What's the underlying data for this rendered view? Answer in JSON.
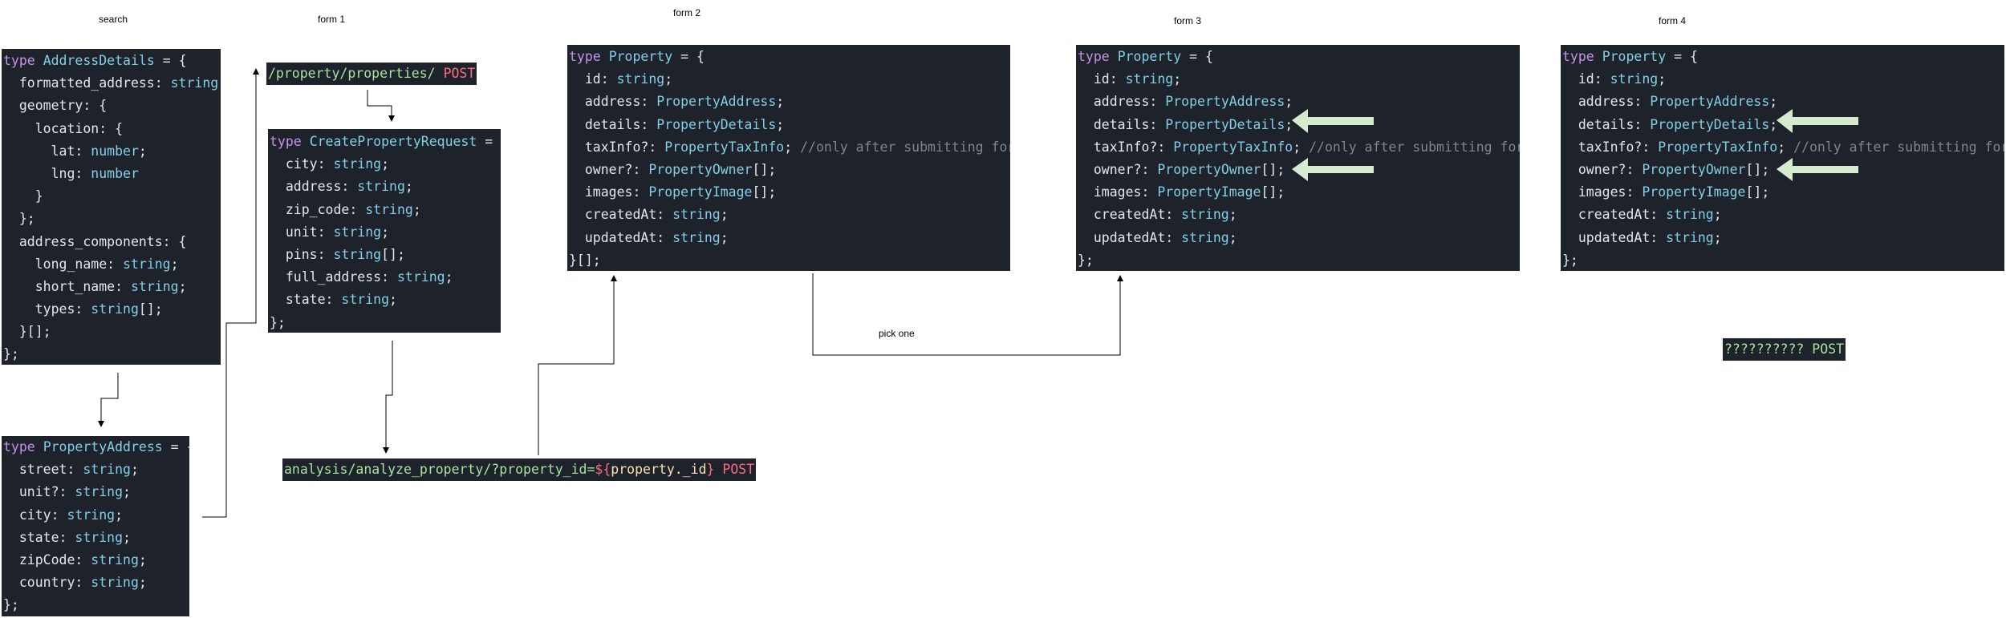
{
  "labels": {
    "search": "search",
    "form1": "form 1",
    "form2": "form 2",
    "form3": "form 3",
    "form4": "form 4",
    "pick_one": "pick one"
  },
  "endpoints": {
    "create_path": "/property/properties/",
    "create_method": "POST",
    "analyze_path": "analysis/analyze_property/?property_id=",
    "analyze_expr_open": "${",
    "analyze_expr_var": "property._id",
    "analyze_expr_close": "}",
    "analyze_method": "POST",
    "unknown_path": "??????????",
    "unknown_method": "POST"
  },
  "code_blocks": {
    "address_details": [
      [
        [
          "kw",
          "type"
        ],
        [
          "pl",
          " "
        ],
        [
          "ty",
          "AddressDetails"
        ],
        [
          "pl",
          " = {"
        ]
      ],
      [
        [
          "pl",
          "  formatted_address: "
        ],
        [
          "ty",
          "string"
        ],
        [
          "pl",
          ";"
        ]
      ],
      [
        [
          "pl",
          "  geometry: {"
        ]
      ],
      [
        [
          "pl",
          "    location: {"
        ]
      ],
      [
        [
          "pl",
          "      lat: "
        ],
        [
          "ty",
          "number"
        ],
        [
          "pl",
          ";"
        ]
      ],
      [
        [
          "pl",
          "      lng: "
        ],
        [
          "ty",
          "number"
        ]
      ],
      [
        [
          "pl",
          "    }"
        ]
      ],
      [
        [
          "pl",
          "  };"
        ]
      ],
      [
        [
          "pl",
          "  address_components: {"
        ]
      ],
      [
        [
          "pl",
          "    long_name: "
        ],
        [
          "ty",
          "string"
        ],
        [
          "pl",
          ";"
        ]
      ],
      [
        [
          "pl",
          "    short_name: "
        ],
        [
          "ty",
          "string"
        ],
        [
          "pl",
          ";"
        ]
      ],
      [
        [
          "pl",
          "    types: "
        ],
        [
          "ty",
          "string"
        ],
        [
          "pl",
          "[];"
        ]
      ],
      [
        [
          "pl",
          "  }[];"
        ]
      ],
      [
        [
          "pl",
          "};"
        ]
      ]
    ],
    "property_address": [
      [
        [
          "kw",
          "type"
        ],
        [
          "pl",
          " "
        ],
        [
          "ty",
          "PropertyAddress"
        ],
        [
          "pl",
          " = {"
        ]
      ],
      [
        [
          "pl",
          "  street: "
        ],
        [
          "ty",
          "string"
        ],
        [
          "pl",
          ";"
        ]
      ],
      [
        [
          "pl",
          "  unit?: "
        ],
        [
          "ty",
          "string"
        ],
        [
          "pl",
          ";"
        ]
      ],
      [
        [
          "pl",
          "  city: "
        ],
        [
          "ty",
          "string"
        ],
        [
          "pl",
          ";"
        ]
      ],
      [
        [
          "pl",
          "  state: "
        ],
        [
          "ty",
          "string"
        ],
        [
          "pl",
          ";"
        ]
      ],
      [
        [
          "pl",
          "  zipCode: "
        ],
        [
          "ty",
          "string"
        ],
        [
          "pl",
          ";"
        ]
      ],
      [
        [
          "pl",
          "  country: "
        ],
        [
          "ty",
          "string"
        ],
        [
          "pl",
          ";"
        ]
      ],
      [
        [
          "pl",
          "};"
        ]
      ]
    ],
    "create_property_request": [
      [
        [
          "kw",
          "type"
        ],
        [
          "pl",
          " "
        ],
        [
          "ty",
          "CreatePropertyRequest"
        ],
        [
          "pl",
          " = {"
        ]
      ],
      [
        [
          "pl",
          "  city: "
        ],
        [
          "ty",
          "string"
        ],
        [
          "pl",
          ";"
        ]
      ],
      [
        [
          "pl",
          "  address: "
        ],
        [
          "ty",
          "string"
        ],
        [
          "pl",
          ";"
        ]
      ],
      [
        [
          "pl",
          "  zip_code: "
        ],
        [
          "ty",
          "string"
        ],
        [
          "pl",
          ";"
        ]
      ],
      [
        [
          "pl",
          "  unit: "
        ],
        [
          "ty",
          "string"
        ],
        [
          "pl",
          ";"
        ]
      ],
      [
        [
          "pl",
          "  pins: "
        ],
        [
          "ty",
          "string"
        ],
        [
          "pl",
          "[];"
        ]
      ],
      [
        [
          "pl",
          "  full_address: "
        ],
        [
          "ty",
          "string"
        ],
        [
          "pl",
          ";"
        ]
      ],
      [
        [
          "pl",
          "  state: "
        ],
        [
          "ty",
          "string"
        ],
        [
          "pl",
          ";"
        ]
      ],
      [
        [
          "pl",
          "};"
        ]
      ]
    ],
    "property_form2": [
      [
        [
          "kw",
          "type"
        ],
        [
          "pl",
          " "
        ],
        [
          "ty",
          "Property"
        ],
        [
          "pl",
          " = {"
        ]
      ],
      [
        [
          "pl",
          "  id: "
        ],
        [
          "ty",
          "string"
        ],
        [
          "pl",
          ";"
        ]
      ],
      [
        [
          "pl",
          "  address: "
        ],
        [
          "ty",
          "PropertyAddress"
        ],
        [
          "pl",
          ";"
        ]
      ],
      [
        [
          "pl",
          "  details: "
        ],
        [
          "ty",
          "PropertyDetails"
        ],
        [
          "pl",
          ";"
        ]
      ],
      [
        [
          "pl",
          "  taxInfo?: "
        ],
        [
          "ty",
          "PropertyTaxInfo"
        ],
        [
          "pl",
          "; "
        ],
        [
          "cm",
          "//only after submitting form"
        ]
      ],
      [
        [
          "pl",
          "  owner?: "
        ],
        [
          "ty",
          "PropertyOwner"
        ],
        [
          "pl",
          "[];"
        ]
      ],
      [
        [
          "pl",
          "  images: "
        ],
        [
          "ty",
          "PropertyImage"
        ],
        [
          "pl",
          "[];"
        ]
      ],
      [
        [
          "pl",
          "  createdAt: "
        ],
        [
          "ty",
          "string"
        ],
        [
          "pl",
          ";"
        ]
      ],
      [
        [
          "pl",
          "  updatedAt: "
        ],
        [
          "ty",
          "string"
        ],
        [
          "pl",
          ";"
        ]
      ],
      [
        [
          "pl",
          "}[];"
        ]
      ]
    ],
    "property_form3": [
      [
        [
          "kw",
          "type"
        ],
        [
          "pl",
          " "
        ],
        [
          "ty",
          "Property"
        ],
        [
          "pl",
          " = {"
        ]
      ],
      [
        [
          "pl",
          "  id: "
        ],
        [
          "ty",
          "string"
        ],
        [
          "pl",
          ";"
        ]
      ],
      [
        [
          "pl",
          "  address: "
        ],
        [
          "ty",
          "PropertyAddress"
        ],
        [
          "pl",
          ";"
        ]
      ],
      [
        [
          "pl",
          "  details: "
        ],
        [
          "ty",
          "PropertyDetails"
        ],
        [
          "pl",
          ";"
        ]
      ],
      [
        [
          "pl",
          "  taxInfo?: "
        ],
        [
          "ty",
          "PropertyTaxInfo"
        ],
        [
          "pl",
          "; "
        ],
        [
          "cm",
          "//only after submitting form"
        ]
      ],
      [
        [
          "pl",
          "  owner?: "
        ],
        [
          "ty",
          "PropertyOwner"
        ],
        [
          "pl",
          "[];"
        ]
      ],
      [
        [
          "pl",
          "  images: "
        ],
        [
          "ty",
          "PropertyImage"
        ],
        [
          "pl",
          "[];"
        ]
      ],
      [
        [
          "pl",
          "  createdAt: "
        ],
        [
          "ty",
          "string"
        ],
        [
          "pl",
          ";"
        ]
      ],
      [
        [
          "pl",
          "  updatedAt: "
        ],
        [
          "ty",
          "string"
        ],
        [
          "pl",
          ";"
        ]
      ],
      [
        [
          "pl",
          "};"
        ]
      ]
    ],
    "property_form4": [
      [
        [
          "kw",
          "type"
        ],
        [
          "pl",
          " "
        ],
        [
          "ty",
          "Property"
        ],
        [
          "pl",
          " = {"
        ]
      ],
      [
        [
          "pl",
          "  id: "
        ],
        [
          "ty",
          "string"
        ],
        [
          "pl",
          ";"
        ]
      ],
      [
        [
          "pl",
          "  address: "
        ],
        [
          "ty",
          "PropertyAddress"
        ],
        [
          "pl",
          ";"
        ]
      ],
      [
        [
          "pl",
          "  details: "
        ],
        [
          "ty",
          "PropertyDetails"
        ],
        [
          "pl",
          ";"
        ]
      ],
      [
        [
          "pl",
          "  taxInfo?: "
        ],
        [
          "ty",
          "PropertyTaxInfo"
        ],
        [
          "pl",
          "; "
        ],
        [
          "cm",
          "//only after submitting form"
        ]
      ],
      [
        [
          "pl",
          "  owner?: "
        ],
        [
          "ty",
          "PropertyOwner"
        ],
        [
          "pl",
          "[];"
        ]
      ],
      [
        [
          "pl",
          "  images: "
        ],
        [
          "ty",
          "PropertyImage"
        ],
        [
          "pl",
          "[];"
        ]
      ],
      [
        [
          "pl",
          "  createdAt: "
        ],
        [
          "ty",
          "string"
        ],
        [
          "pl",
          ";"
        ]
      ],
      [
        [
          "pl",
          "  updatedAt: "
        ],
        [
          "ty",
          "string"
        ],
        [
          "pl",
          ";"
        ]
      ],
      [
        [
          "pl",
          "};"
        ]
      ]
    ]
  },
  "colors": {
    "code_bg": "#1e222a",
    "keyword": "#c792ea",
    "type": "#82cfe8",
    "comment": "#7f848e",
    "endpoint_path": "#a6e3a1",
    "endpoint_method": "#ff6b81",
    "template_var": "#f9e2af",
    "highlight_arrow": "#d6ead0"
  }
}
